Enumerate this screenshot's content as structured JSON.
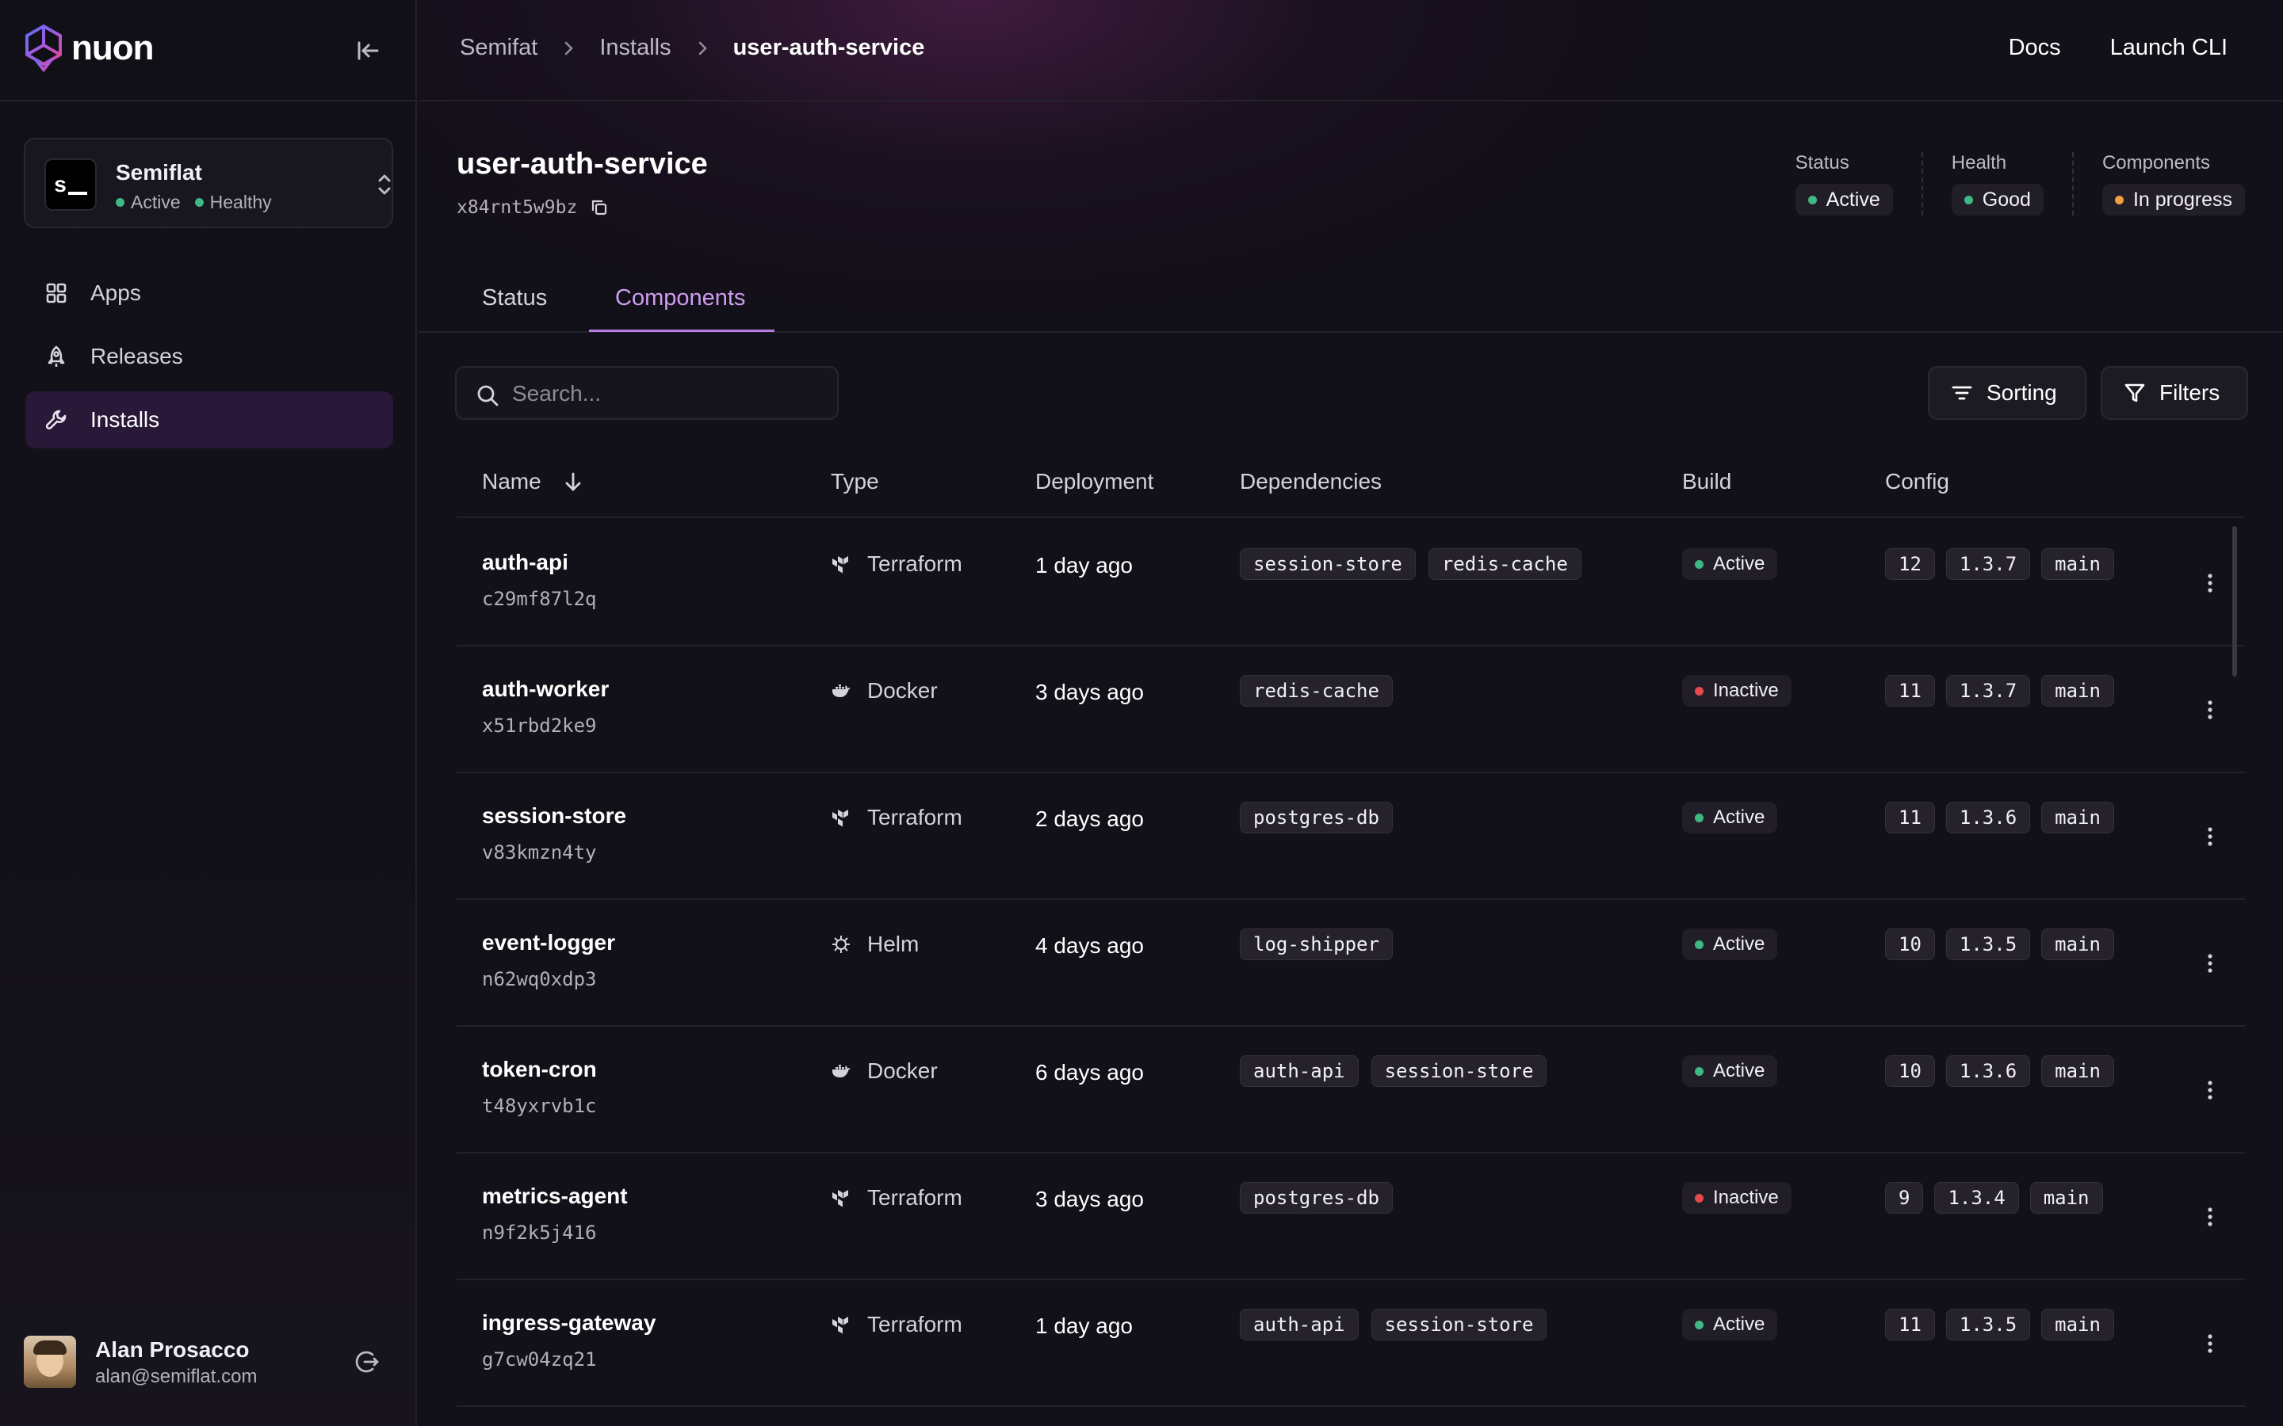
{
  "app": {
    "name": "nuon"
  },
  "org": {
    "initials": "s",
    "name": "Semiflat",
    "status": "Active",
    "health": "Healthy"
  },
  "nav": {
    "apps": "Apps",
    "releases": "Releases",
    "installs": "Installs"
  },
  "user": {
    "name": "Alan Prosacco",
    "email": "alan@semiflat.com"
  },
  "breadcrumb": {
    "org": "Semifat",
    "section": "Installs",
    "current": "user-auth-service"
  },
  "top_links": {
    "docs": "Docs",
    "cli": "Launch CLI"
  },
  "install": {
    "title": "user-auth-service",
    "id": "x84rnt5w9bz"
  },
  "summary": {
    "status_label": "Status",
    "status_value": "Active",
    "health_label": "Health",
    "health_value": "Good",
    "components_label": "Components",
    "components_value": "In progress"
  },
  "tabs": {
    "status": "Status",
    "components": "Components"
  },
  "search": {
    "placeholder": "Search..."
  },
  "toolbar": {
    "sorting": "Sorting",
    "filters": "Filters"
  },
  "columns": {
    "name": "Name",
    "type": "Type",
    "deployment": "Deployment",
    "dependencies": "Dependencies",
    "build": "Build",
    "config": "Config"
  },
  "components": [
    {
      "name": "auth-api",
      "id": "c29mf87l2q",
      "type": "Terraform",
      "deployment": "1 day ago",
      "deps": [
        "session-store",
        "redis-cache"
      ],
      "build": "Active",
      "config": [
        "12",
        "1.3.7",
        "main"
      ]
    },
    {
      "name": "auth-worker",
      "id": "x51rbd2ke9",
      "type": "Docker",
      "deployment": "3 days ago",
      "deps": [
        "redis-cache"
      ],
      "build": "Inactive",
      "config": [
        "11",
        "1.3.7",
        "main"
      ]
    },
    {
      "name": "session-store",
      "id": "v83kmzn4ty",
      "type": "Terraform",
      "deployment": "2 days ago",
      "deps": [
        "postgres-db"
      ],
      "build": "Active",
      "config": [
        "11",
        "1.3.6",
        "main"
      ]
    },
    {
      "name": "event-logger",
      "id": "n62wq0xdp3",
      "type": "Helm",
      "deployment": "4 days ago",
      "deps": [
        "log-shipper"
      ],
      "build": "Active",
      "config": [
        "10",
        "1.3.5",
        "main"
      ]
    },
    {
      "name": "token-cron",
      "id": "t48yxrvb1c",
      "type": "Docker",
      "deployment": "6 days ago",
      "deps": [
        "auth-api",
        "session-store"
      ],
      "build": "Active",
      "config": [
        "10",
        "1.3.6",
        "main"
      ]
    },
    {
      "name": "metrics-agent",
      "id": "n9f2k5j416",
      "type": "Terraform",
      "deployment": "3 days ago",
      "deps": [
        "postgres-db"
      ],
      "build": "Inactive",
      "config": [
        "9",
        "1.3.4",
        "main"
      ]
    },
    {
      "name": "ingress-gateway",
      "id": "g7cw04zq21",
      "type": "Terraform",
      "deployment": "1 day ago",
      "deps": [
        "auth-api",
        "session-store"
      ],
      "build": "Active",
      "config": [
        "11",
        "1.3.5",
        "main"
      ]
    }
  ],
  "colors": {
    "accent": "#b57be0",
    "active": "#3fb884",
    "inactive": "#e5484d",
    "progress": "#f59e42"
  }
}
